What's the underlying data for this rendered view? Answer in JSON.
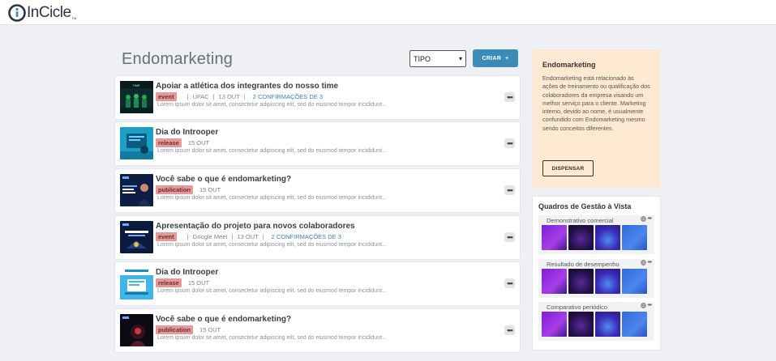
{
  "app": {
    "logo_text": "InCicle",
    "logo_tm": "TM"
  },
  "page": {
    "title": "Endomarketing",
    "type_select": "TIPO",
    "create_label": "CRIAR",
    "create_icon": "plus-icon"
  },
  "feed": [
    {
      "title": "Apoiar a atlética dos integrantes do nosso time",
      "tag": "event",
      "meta": [
        "UFAC",
        "13 OUT"
      ],
      "confirmations": "2 CONFIRMAÇÕES DE 3",
      "description": "Lorem ipsum dolor sit amet, consectetur adipiscing elit, sed do eiusmod tempor incididunt...",
      "thumb": "team-dark"
    },
    {
      "title": "Dia do Introoper",
      "tag": "release",
      "meta": [
        "15 OUT"
      ],
      "confirmations": "",
      "description": "Lorem ipsum dolor sit amet, consectetur adipiscing elit, sed do eiusmod tempor incididunt...",
      "thumb": "teal-blue"
    },
    {
      "title": "Você sabe o que é endomarketing?",
      "tag": "publication",
      "meta": [
        "15 OUT"
      ],
      "confirmations": "",
      "description": "Lorem ipsum dolor sit amet, consectetur adipiscing elit, sed do eiusmod tempor incididunt...",
      "thumb": "navy-person"
    },
    {
      "title": "Apresentação do projeto para novos colaboradores",
      "tag": "event",
      "meta": [
        "Google Meet",
        "13 OUT"
      ],
      "confirmations": "2 CONFIRMAÇÕES DE 3",
      "description": "Lorem ipsum dolor sit amet, consectetur adipiscing elit, sed do eiusmod tempor incididunt...",
      "thumb": "navy-stage"
    },
    {
      "title": "Dia do Introoper",
      "tag": "release",
      "meta": [
        "15 OUT"
      ],
      "confirmations": "",
      "description": "Lorem ipsum dolor sit amet, consectetur adipiscing elit, sed do eiusmod tempor incididunt...",
      "thumb": "cyan-screen"
    },
    {
      "title": "Você sabe o que é endomarketing?",
      "tag": "publication",
      "meta": [
        "15 OUT"
      ],
      "confirmations": "",
      "description": "Lorem ipsum dolor sit amet, consectetur adipiscing elit, sed do eiusmod tempor incididunt...",
      "thumb": "dark-red"
    }
  ],
  "more_label": "•••",
  "info": {
    "title": "Endomarketing",
    "text": "Endomarketing está relacionado às ações de treinamento ou qualificação dos colaboradores da empresa visando um melhor serviço para o cliente. Marketing interno, devido ao nome, é usualmente confundido com Endomarketing mesmo sendo conceitos diferentes.",
    "dismiss_label": "DISPENSAR"
  },
  "boards": {
    "title": "Quadros de Gestão à Vista",
    "items": [
      {
        "name": "Demonstrativo comercial",
        "icons": "🌐 •••"
      },
      {
        "name": "Resultado de desempenho",
        "icons": "🌐 •••"
      },
      {
        "name": "Comparativo periódico",
        "icons": "🌐 •••"
      }
    ]
  },
  "colors": {
    "accent": "#3a8cb8",
    "tag_bg": "#e6999a",
    "info_bg": "#fde9d2",
    "link": "#3a7fb4"
  }
}
